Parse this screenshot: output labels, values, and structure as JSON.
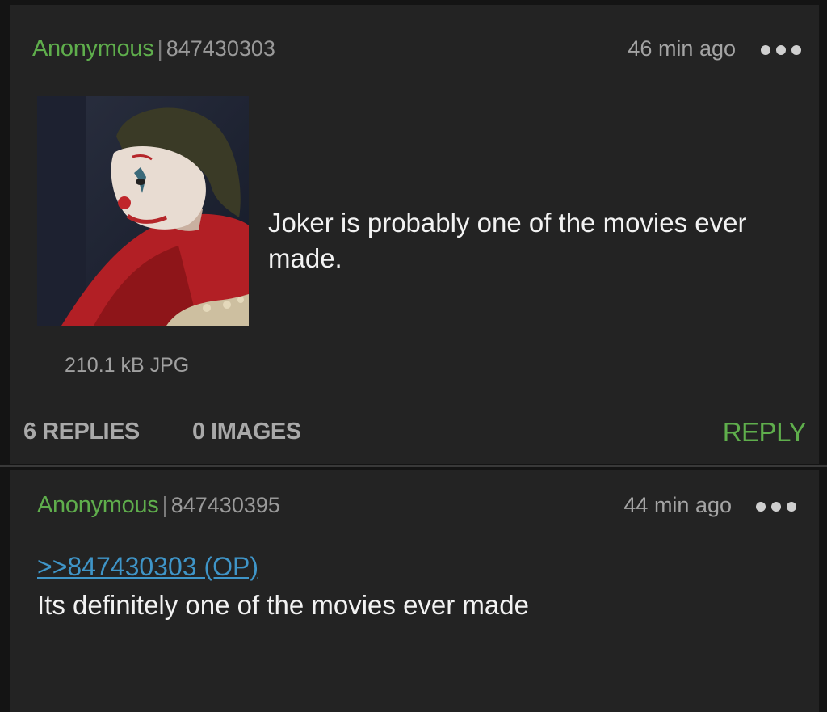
{
  "op": {
    "author": "Anonymous",
    "separator": "|",
    "post_id": "847430303",
    "time": "46 min ago",
    "image_alt": "Joker thumbnail",
    "file_info": "210.1 kB JPG",
    "text": "Joker is probably one of the movies ever made.",
    "replies_label": "6 REPLIES",
    "images_label": "0 IMAGES",
    "reply_label": "REPLY"
  },
  "reply": {
    "author": "Anonymous",
    "separator": "|",
    "post_id": "847430395",
    "time": "44 min ago",
    "quote": ">>847430303 (OP)",
    "text": "Its definitely one of the movies ever made"
  },
  "colors": {
    "name": "#5fae4c",
    "link": "#3f95c8",
    "card": "#232323",
    "background": "#141414"
  },
  "icons": {
    "more": "more-options-icon"
  }
}
